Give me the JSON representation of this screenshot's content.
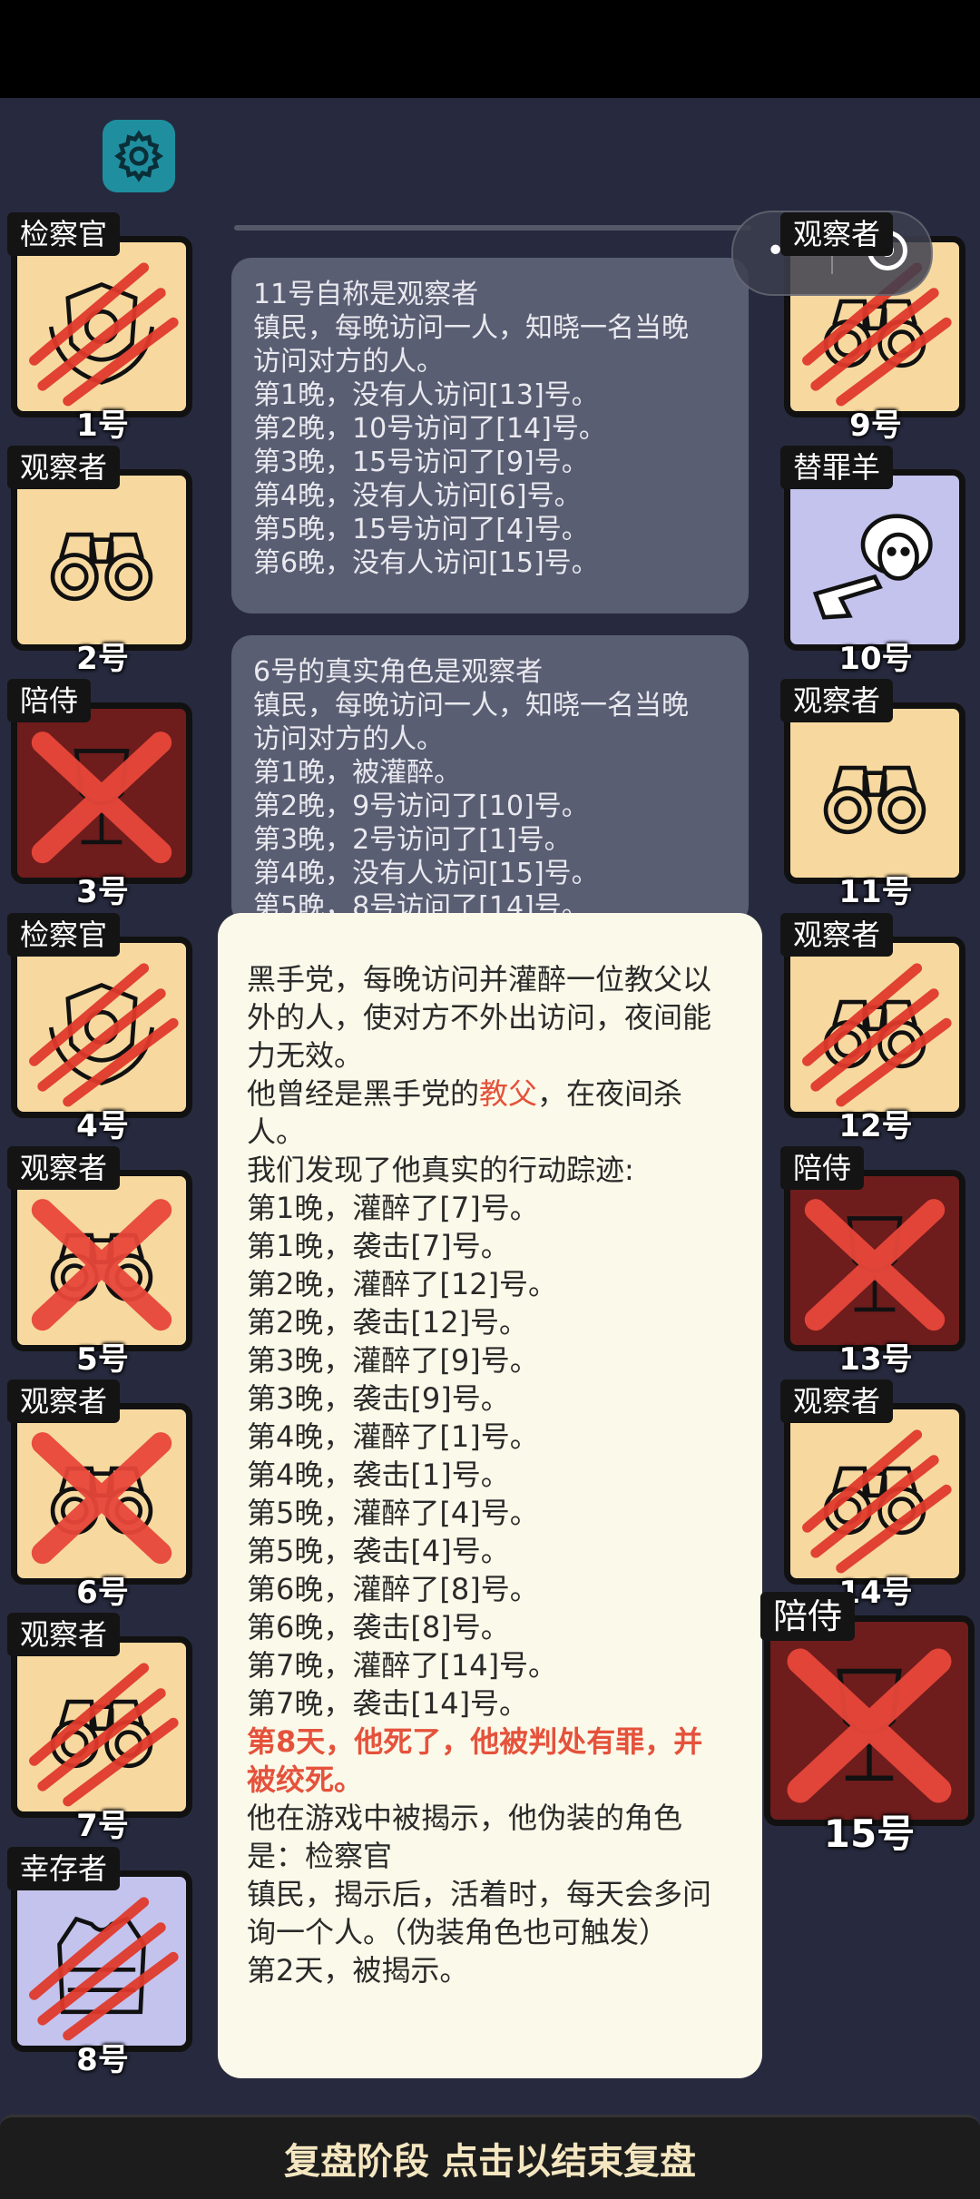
{
  "icons": {
    "settings": "gear-icon",
    "more": "ellipsis-icon",
    "close": "target-circle-icon",
    "observer": "binoculars-icon",
    "prosecutor": "badge-icon",
    "escort": "wine-glass-icon",
    "scapegoat": "sheep-pointing-icon",
    "survivor": "vest-icon",
    "killed": "claw-marks-icon",
    "executed": "red-cross-icon"
  },
  "colors": {
    "background": "#272a3e",
    "card_light": "#f7d9a0",
    "card_dark_red": "#6e1c1c",
    "card_lavender": "#c4c3ee",
    "accent_red": "#e5523c",
    "gear": "#1f8fa0"
  },
  "players": [
    {
      "number": "1号",
      "role": "检察官",
      "mark": "claw"
    },
    {
      "number": "2号",
      "role": "观察者",
      "mark": "none"
    },
    {
      "number": "3号",
      "role": "陪侍",
      "mark": "cross"
    },
    {
      "number": "4号",
      "role": "检察官",
      "mark": "claw"
    },
    {
      "number": "5号",
      "role": "观察者",
      "mark": "cross"
    },
    {
      "number": "6号",
      "role": "观察者",
      "mark": "cross"
    },
    {
      "number": "7号",
      "role": "观察者",
      "mark": "claw"
    },
    {
      "number": "8号",
      "role": "幸存者",
      "mark": "claw"
    },
    {
      "number": "9号",
      "role": "观察者",
      "mark": "claw"
    },
    {
      "number": "10号",
      "role": "替罪羊",
      "mark": "none"
    },
    {
      "number": "11号",
      "role": "观察者",
      "mark": "none"
    },
    {
      "number": "12号",
      "role": "观察者",
      "mark": "claw"
    },
    {
      "number": "13号",
      "role": "陪侍",
      "mark": "cross"
    },
    {
      "number": "14号",
      "role": "观察者",
      "mark": "claw"
    },
    {
      "number": "15号",
      "role": "陪侍",
      "mark": "cross"
    }
  ],
  "messages": [
    {
      "lines": [
        "11号自称是观察者",
        "镇民，每晚访问一人，知晓一名当晚",
        "访问对方的人。",
        "第1晚，没有人访问[13]号。",
        "第2晚，10号访问了[14]号。",
        "第3晚，15号访问了[9]号。",
        "第4晚，没有人访问[6]号。",
        "第5晚，15号访问了[4]号。",
        "第6晚，没有人访问[15]号。"
      ]
    },
    {
      "lines": [
        "6号的真实角色是观察者",
        "镇民，每晚访问一人，知晓一名当晚",
        "访问对方的人。",
        "第1晚，被灌醉。",
        "第2晚，9号访问了[10]号。",
        "第3晚，2号访问了[1]号。",
        "第4晚，没有人访问[15]号。",
        "第5晚，8号访问了[14]号。"
      ]
    }
  ],
  "detail": {
    "intro": "黑手党，每晚访问并灌醉一位教父以外的人，使对方不外出访问，夜间能力无效。",
    "was_prefix": "他曾经是黑手党的",
    "was_role": "教父",
    "was_suffix": "，在夜间杀人。",
    "trace_header": "我们发现了他真实的行动踪迹:",
    "trace": [
      "第1晚，灌醉了[7]号。",
      "第1晚，袭击[7]号。",
      "第2晚，灌醉了[12]号。",
      "第2晚，袭击[12]号。",
      "第3晚，灌醉了[9]号。",
      "第3晚，袭击[9]号。",
      "第4晚，灌醉了[1]号。",
      "第4晚，袭击[1]号。",
      "第5晚，灌醉了[4]号。",
      "第5晚，袭击[4]号。",
      "第6晚，灌醉了[8]号。",
      "第6晚，袭击[8]号。",
      "第7晚，灌醉了[14]号。",
      "第7晚，袭击[14]号。"
    ],
    "death": "第8天，他死了，他被判处有罪，并被绞死。",
    "disguise": "他在游戏中被揭示，他伪装的角色是：检察官",
    "disguise_desc": "镇民，揭示后，活着时，每天会多问询一个人。（伪装角色也可触发）",
    "revealed": "第2天，被揭示。"
  },
  "footer": {
    "label": "复盘阶段 点击以结束复盘"
  }
}
